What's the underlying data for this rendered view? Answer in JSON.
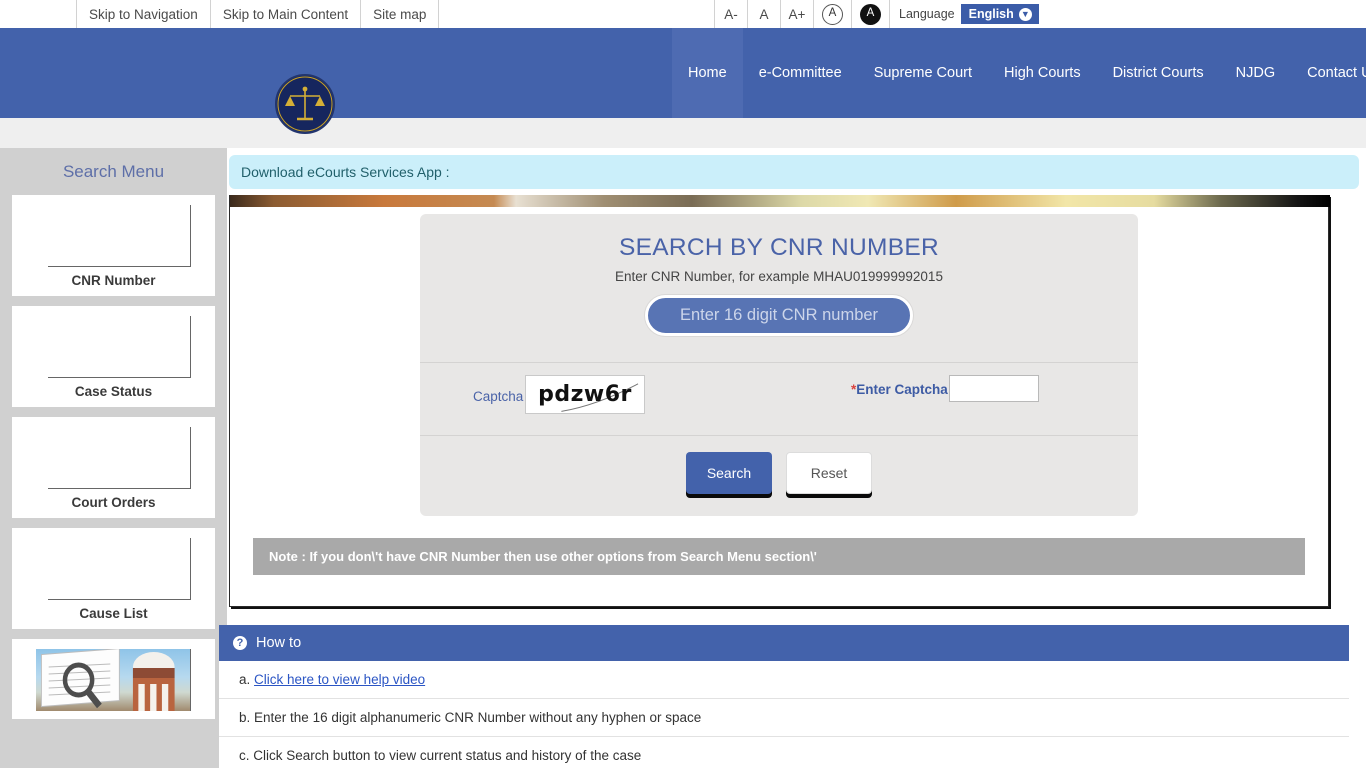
{
  "topbar": {
    "skip_links": [
      {
        "label": "Skip to Navigation"
      },
      {
        "label": "Skip to Main Content"
      },
      {
        "label": "Site map"
      }
    ],
    "font_buttons": [
      {
        "label": "A-",
        "name": "font-decrease-button"
      },
      {
        "label": "A",
        "name": "font-normal-button"
      },
      {
        "label": "A+",
        "name": "font-increase-button"
      }
    ],
    "contrast_light": "A",
    "contrast_dark": "A",
    "language_label": "Language",
    "language_value": "English",
    "language_caret": "▼"
  },
  "header": {
    "logo_alt": "ecourts-emblem",
    "nav": [
      {
        "label": "Home",
        "active": true
      },
      {
        "label": "e-Committee",
        "active": false
      },
      {
        "label": "Supreme Court",
        "active": false
      },
      {
        "label": "High Courts",
        "active": false
      },
      {
        "label": "District Courts",
        "active": false
      },
      {
        "label": "NJDG",
        "active": false
      },
      {
        "label": "Contact Us",
        "active": false
      }
    ]
  },
  "sidebar": {
    "title": "Search Menu",
    "items": [
      {
        "label": "CNR Number",
        "has_image": false
      },
      {
        "label": "Case Status",
        "has_image": false
      },
      {
        "label": "Court Orders",
        "has_image": false
      },
      {
        "label": "Cause List",
        "has_image": false
      },
      {
        "label": "",
        "has_image": true
      }
    ]
  },
  "banner": {
    "text": "Download eCourts Services App :"
  },
  "search": {
    "title": "SEARCH BY CNR NUMBER",
    "subtitle": "Enter CNR Number, for example MHAU019999992015",
    "cnr_placeholder": "Enter 16 digit CNR number",
    "cnr_value": "",
    "captcha_label": "Captcha",
    "captcha_text": "pdzw6r",
    "enter_captcha_star": "*",
    "enter_captcha_label": "Enter Captcha",
    "captcha_value": "",
    "search_button": "Search",
    "reset_button": "Reset",
    "note": "Note : If you don\\'t have CNR Number then use other options from Search Menu section\\'"
  },
  "howto": {
    "heading": "How to",
    "icon": "?",
    "rows": [
      {
        "prefix": "a.",
        "text": "Click here to view help video",
        "is_link": true
      },
      {
        "prefix": "b.",
        "text": "Enter the 16 digit alphanumeric CNR Number without any hyphen or space",
        "is_link": false
      },
      {
        "prefix": "c.",
        "text": "Click Search button to view current status and history of the case",
        "is_link": false
      }
    ]
  },
  "colors": {
    "header_blue": "#4362ab",
    "nav_active": "#4e6bb2",
    "banner_cyan": "#cbeffa",
    "panel_gray": "#e8e7e6",
    "sidebar_gray": "#d0d0d0",
    "note_gray": "#a9a9a9",
    "link_blue": "#2b55c4",
    "title_blue": "#4a63a8",
    "required_red": "#d9433f"
  }
}
